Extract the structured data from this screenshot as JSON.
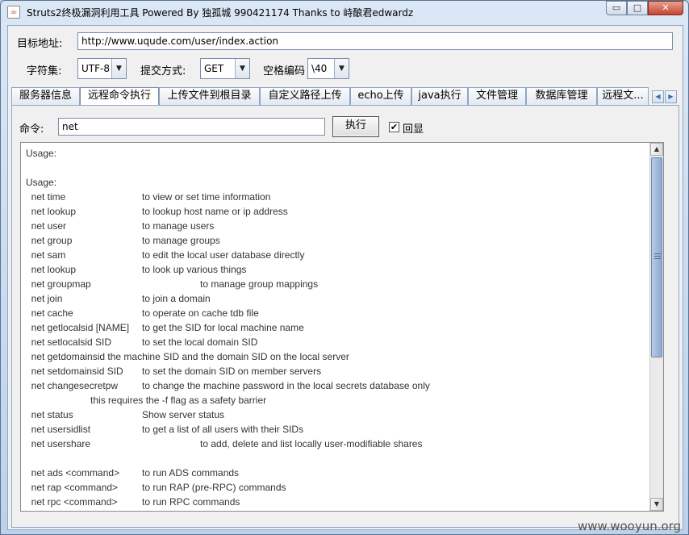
{
  "window": {
    "title": "Struts2终极漏洞利用工具   Powered By 独孤城 990421174 Thanks to 峙酿君edwardz",
    "icon": "java-coffee-icon",
    "minimize_glyph": "▭",
    "maximize_glyph": "□",
    "close_glyph": "✕"
  },
  "target": {
    "label": "目标地址:",
    "url": "http://www.uqude.com/user/index.action"
  },
  "options": {
    "charset_label": "字符集:",
    "charset_value": "UTF-8",
    "method_label": "提交方式:",
    "method_value": "GET",
    "space_label": "空格编码",
    "space_value": "\\40",
    "arrow_glyph": "▼"
  },
  "tabs": [
    {
      "label": "服务器信息",
      "active": false
    },
    {
      "label": "远程命令执行",
      "active": true
    },
    {
      "label": "上传文件到根目录",
      "active": false
    },
    {
      "label": "自定义路径上传",
      "active": false
    },
    {
      "label": "echo上传",
      "active": false
    },
    {
      "label": "java执行",
      "active": false
    },
    {
      "label": "文件管理",
      "active": false
    },
    {
      "label": "数据库管理",
      "active": false
    },
    {
      "label": "远程文...",
      "active": false
    }
  ],
  "tab_scroll": {
    "left_glyph": "◀",
    "right_glyph": "▶"
  },
  "command": {
    "label": "命令:",
    "value": "net",
    "execute_label": "执行",
    "echo_label": "回显",
    "echo_checked": true,
    "check_glyph": "✔"
  },
  "scrollbar": {
    "up_glyph": "▲",
    "down_glyph": "▼"
  },
  "output": [
    {
      "c1": "Usage:",
      "c2": ""
    },
    {
      "c1": "",
      "c2": ""
    },
    {
      "c1": "Usage:",
      "c2": ""
    },
    {
      "c1": "  net time",
      "c2": "to view or set time information"
    },
    {
      "c1": "  net lookup",
      "c2": "to lookup host name or ip address"
    },
    {
      "c1": "  net user",
      "c2": "to manage users"
    },
    {
      "c1": "  net group",
      "c2": "to manage groups"
    },
    {
      "c1": "  net sam",
      "c2": "to edit the local user database directly"
    },
    {
      "c1": "  net lookup",
      "c2": "to look up various things"
    },
    {
      "c1": "  net groupmap",
      "c2": "to manage group mappings",
      "wide": true
    },
    {
      "c1": "  net join",
      "c2": "to join a domain"
    },
    {
      "c1": "  net cache",
      "c2": "to operate on cache tdb file"
    },
    {
      "c1": "  net getlocalsid [NAME]",
      "c2": "to get the SID for local machine name"
    },
    {
      "c1": "  net setlocalsid SID",
      "c2": "to set the local domain SID"
    },
    {
      "c1": "  net getdomainsid the machine SID and the domain SID on the local server",
      "c2": ""
    },
    {
      "c1": "  net setdomainsid SID",
      "c2": "to set the domain SID on member servers"
    },
    {
      "c1": "  net changesecretpw",
      "c2": "to change the machine password in the local secrets database only"
    },
    {
      "c1": "                        this requires the -f flag as a safety barrier",
      "c2": ""
    },
    {
      "c1": "  net status",
      "c2": "Show server status"
    },
    {
      "c1": "  net usersidlist",
      "c2": "to get a list of all users with their SIDs"
    },
    {
      "c1": "  net usershare",
      "c2": "to add, delete and list locally user-modifiable shares",
      "wide": true
    },
    {
      "c1": "",
      "c2": ""
    },
    {
      "c1": "  net ads <command>",
      "c2": "to run ADS commands"
    },
    {
      "c1": "  net rap <command>",
      "c2": "to run RAP (pre-RPC) commands"
    },
    {
      "c1": "  net rpc <command>",
      "c2": "to run RPC commands"
    }
  ],
  "watermark": "www.wooyun.org"
}
